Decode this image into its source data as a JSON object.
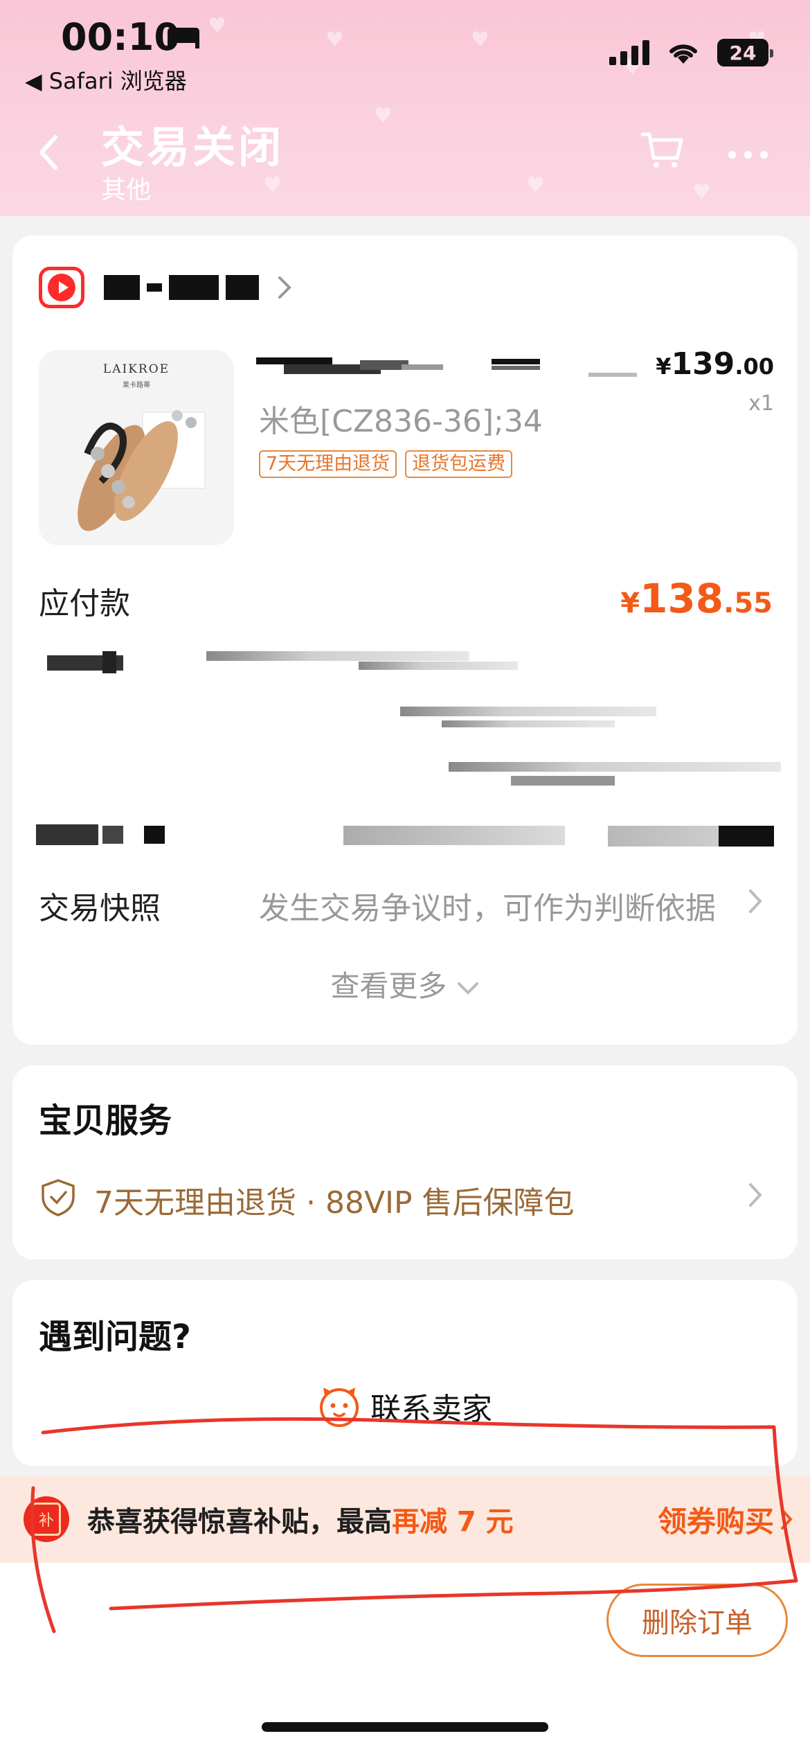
{
  "status_bar": {
    "time": "00:10",
    "back_app": "◀ Safari 浏览器",
    "battery": "24"
  },
  "header": {
    "title": "交易关闭",
    "subtitle": "其他"
  },
  "product": {
    "brand": "LAIKROE",
    "brand_sub": "莱卡路蒂",
    "price_currency": "¥",
    "price_int": "139",
    "price_dec": ".00",
    "quantity": "x1",
    "variant": "米色[CZ836-36];34",
    "tags": [
      "7天无理由退货",
      "退货包运费"
    ]
  },
  "payment": {
    "label": "应付款",
    "currency": "¥",
    "amount_int": "138",
    "amount_dec": ".55"
  },
  "snapshot": {
    "label": "交易快照",
    "value": "发生交易争议时，可作为判断依据"
  },
  "see_more": "查看更多",
  "service": {
    "title": "宝贝服务",
    "text": "7天无理由退货 · 88VIP 售后保障包"
  },
  "help": {
    "title": "遇到问题?",
    "contact": "联系卖家"
  },
  "promo": {
    "badge": "补",
    "text_prefix": "恭喜获得惊喜补贴，最高",
    "text_highlight": "再减 7 元",
    "action": "领券购买"
  },
  "bottom": {
    "delete_button": "删除订单"
  },
  "colors": {
    "accent": "#f35a17",
    "header_pink": "#fbd2df",
    "tag_orange": "#e8742a",
    "service_brown": "#9a6a36",
    "annotation_red": "#e8362a"
  }
}
